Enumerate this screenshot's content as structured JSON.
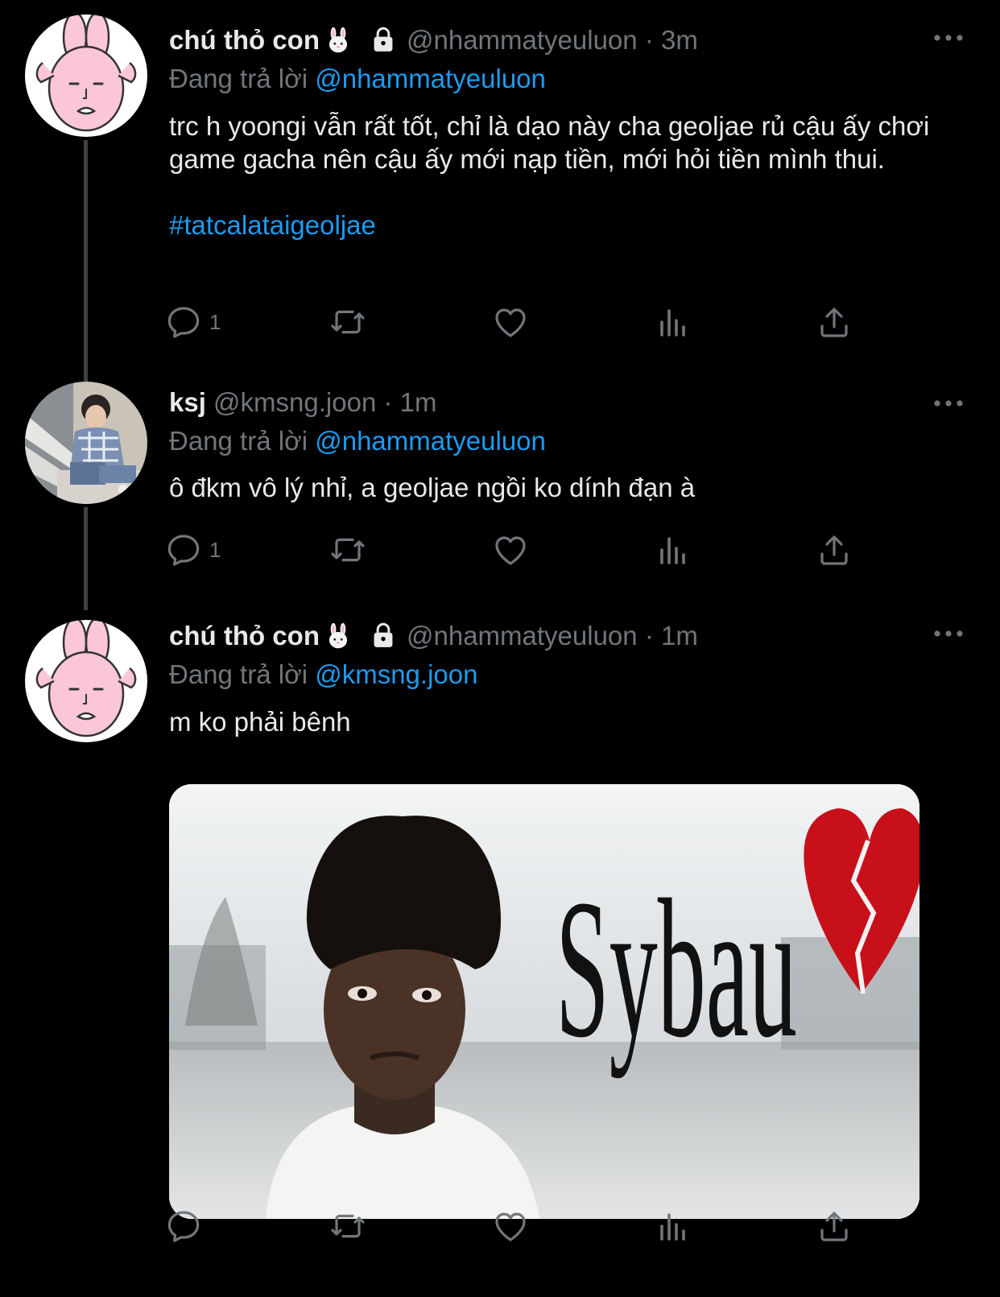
{
  "tweets": [
    {
      "name": "chú thỏ con",
      "handle": "@nhammatyeuluon",
      "dot": "·",
      "time": "3m",
      "replying_prefix": "Đang trả lời",
      "replying_to": "@nhammatyeuluon",
      "text": "trc h yoongi vẫn rất tốt, chỉ là dạo này cha geoljae rủ cậu ấy chơi game gacha nên cậu ấy mới nạp tiền, mới hỏi tiền mình thui.",
      "hashtag": "#tatcalataigeoljae",
      "reply_count": "1"
    },
    {
      "name": "ksj",
      "handle": "@kmsng.joon",
      "dot": "·",
      "time": "1m",
      "replying_prefix": "Đang trả lời",
      "replying_to": "@nhammatyeuluon",
      "text": "ô đkm vô lý nhỉ, a geoljae ngồi ko dính đạn à",
      "reply_count": "1"
    },
    {
      "name": "chú thỏ con",
      "handle": "@nhammatyeuluon",
      "dot": "·",
      "time": "1m",
      "replying_prefix": "Đang trả lời",
      "replying_to": "@kmsng.joon",
      "text": "m ko phải bênh",
      "media_caption": "Sybau"
    }
  ],
  "icons": {
    "reply": "reply-icon",
    "retweet": "retweet-icon",
    "like": "heart-icon",
    "views": "analytics-icon",
    "share": "share-icon",
    "more": "more-icon",
    "lock": "lock-icon",
    "emoji": "rabbit-emoji"
  },
  "colors": {
    "background": "#000000",
    "text": "#e7e9ea",
    "muted": "#71767b",
    "link": "#1d9bf0",
    "thread_line": "#3e4144"
  }
}
